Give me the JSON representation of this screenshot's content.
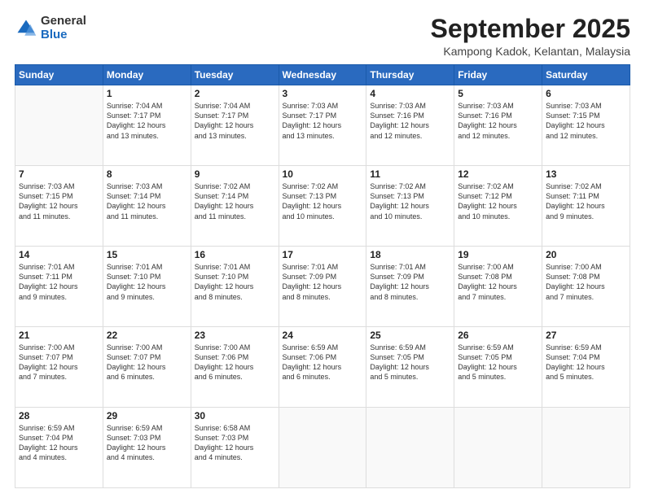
{
  "header": {
    "logo_general": "General",
    "logo_blue": "Blue",
    "month_title": "September 2025",
    "subtitle": "Kampong Kadok, Kelantan, Malaysia"
  },
  "days_of_week": [
    "Sunday",
    "Monday",
    "Tuesday",
    "Wednesday",
    "Thursday",
    "Friday",
    "Saturday"
  ],
  "weeks": [
    [
      {
        "day": "",
        "info": ""
      },
      {
        "day": "1",
        "info": "Sunrise: 7:04 AM\nSunset: 7:17 PM\nDaylight: 12 hours\nand 13 minutes."
      },
      {
        "day": "2",
        "info": "Sunrise: 7:04 AM\nSunset: 7:17 PM\nDaylight: 12 hours\nand 13 minutes."
      },
      {
        "day": "3",
        "info": "Sunrise: 7:03 AM\nSunset: 7:17 PM\nDaylight: 12 hours\nand 13 minutes."
      },
      {
        "day": "4",
        "info": "Sunrise: 7:03 AM\nSunset: 7:16 PM\nDaylight: 12 hours\nand 12 minutes."
      },
      {
        "day": "5",
        "info": "Sunrise: 7:03 AM\nSunset: 7:16 PM\nDaylight: 12 hours\nand 12 minutes."
      },
      {
        "day": "6",
        "info": "Sunrise: 7:03 AM\nSunset: 7:15 PM\nDaylight: 12 hours\nand 12 minutes."
      }
    ],
    [
      {
        "day": "7",
        "info": "Sunrise: 7:03 AM\nSunset: 7:15 PM\nDaylight: 12 hours\nand 11 minutes."
      },
      {
        "day": "8",
        "info": "Sunrise: 7:03 AM\nSunset: 7:14 PM\nDaylight: 12 hours\nand 11 minutes."
      },
      {
        "day": "9",
        "info": "Sunrise: 7:02 AM\nSunset: 7:14 PM\nDaylight: 12 hours\nand 11 minutes."
      },
      {
        "day": "10",
        "info": "Sunrise: 7:02 AM\nSunset: 7:13 PM\nDaylight: 12 hours\nand 10 minutes."
      },
      {
        "day": "11",
        "info": "Sunrise: 7:02 AM\nSunset: 7:13 PM\nDaylight: 12 hours\nand 10 minutes."
      },
      {
        "day": "12",
        "info": "Sunrise: 7:02 AM\nSunset: 7:12 PM\nDaylight: 12 hours\nand 10 minutes."
      },
      {
        "day": "13",
        "info": "Sunrise: 7:02 AM\nSunset: 7:11 PM\nDaylight: 12 hours\nand 9 minutes."
      }
    ],
    [
      {
        "day": "14",
        "info": "Sunrise: 7:01 AM\nSunset: 7:11 PM\nDaylight: 12 hours\nand 9 minutes."
      },
      {
        "day": "15",
        "info": "Sunrise: 7:01 AM\nSunset: 7:10 PM\nDaylight: 12 hours\nand 9 minutes."
      },
      {
        "day": "16",
        "info": "Sunrise: 7:01 AM\nSunset: 7:10 PM\nDaylight: 12 hours\nand 8 minutes."
      },
      {
        "day": "17",
        "info": "Sunrise: 7:01 AM\nSunset: 7:09 PM\nDaylight: 12 hours\nand 8 minutes."
      },
      {
        "day": "18",
        "info": "Sunrise: 7:01 AM\nSunset: 7:09 PM\nDaylight: 12 hours\nand 8 minutes."
      },
      {
        "day": "19",
        "info": "Sunrise: 7:00 AM\nSunset: 7:08 PM\nDaylight: 12 hours\nand 7 minutes."
      },
      {
        "day": "20",
        "info": "Sunrise: 7:00 AM\nSunset: 7:08 PM\nDaylight: 12 hours\nand 7 minutes."
      }
    ],
    [
      {
        "day": "21",
        "info": "Sunrise: 7:00 AM\nSunset: 7:07 PM\nDaylight: 12 hours\nand 7 minutes."
      },
      {
        "day": "22",
        "info": "Sunrise: 7:00 AM\nSunset: 7:07 PM\nDaylight: 12 hours\nand 6 minutes."
      },
      {
        "day": "23",
        "info": "Sunrise: 7:00 AM\nSunset: 7:06 PM\nDaylight: 12 hours\nand 6 minutes."
      },
      {
        "day": "24",
        "info": "Sunrise: 6:59 AM\nSunset: 7:06 PM\nDaylight: 12 hours\nand 6 minutes."
      },
      {
        "day": "25",
        "info": "Sunrise: 6:59 AM\nSunset: 7:05 PM\nDaylight: 12 hours\nand 5 minutes."
      },
      {
        "day": "26",
        "info": "Sunrise: 6:59 AM\nSunset: 7:05 PM\nDaylight: 12 hours\nand 5 minutes."
      },
      {
        "day": "27",
        "info": "Sunrise: 6:59 AM\nSunset: 7:04 PM\nDaylight: 12 hours\nand 5 minutes."
      }
    ],
    [
      {
        "day": "28",
        "info": "Sunrise: 6:59 AM\nSunset: 7:04 PM\nDaylight: 12 hours\nand 4 minutes."
      },
      {
        "day": "29",
        "info": "Sunrise: 6:59 AM\nSunset: 7:03 PM\nDaylight: 12 hours\nand 4 minutes."
      },
      {
        "day": "30",
        "info": "Sunrise: 6:58 AM\nSunset: 7:03 PM\nDaylight: 12 hours\nand 4 minutes."
      },
      {
        "day": "",
        "info": ""
      },
      {
        "day": "",
        "info": ""
      },
      {
        "day": "",
        "info": ""
      },
      {
        "day": "",
        "info": ""
      }
    ]
  ]
}
